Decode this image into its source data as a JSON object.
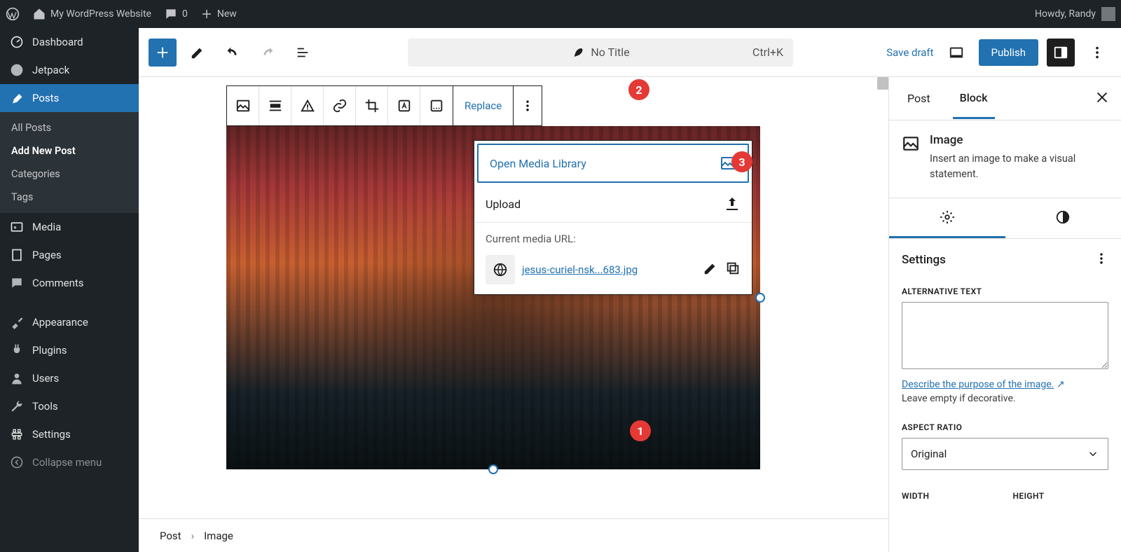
{
  "admin_bar": {
    "site_title": "My WordPress Website",
    "comments_count": "0",
    "new_label": "New",
    "greeting": "Howdy, Randy"
  },
  "sidebar": {
    "items": [
      {
        "label": "Dashboard"
      },
      {
        "label": "Jetpack"
      },
      {
        "label": "Posts"
      },
      {
        "label": "Media"
      },
      {
        "label": "Pages"
      },
      {
        "label": "Comments"
      },
      {
        "label": "Appearance"
      },
      {
        "label": "Plugins"
      },
      {
        "label": "Users"
      },
      {
        "label": "Tools"
      },
      {
        "label": "Settings"
      },
      {
        "label": "Collapse menu"
      }
    ],
    "posts_submenu": [
      "All Posts",
      "Add New Post",
      "Categories",
      "Tags"
    ]
  },
  "editor_header": {
    "title": "No Title",
    "shortcut": "Ctrl+K",
    "save_draft": "Save draft",
    "publish": "Publish"
  },
  "block_toolbar": {
    "replace": "Replace"
  },
  "replace_popover": {
    "open_media": "Open Media Library",
    "upload": "Upload",
    "current_url_label": "Current media URL:",
    "filename": "jesus-curiel-nsk...683.jpg"
  },
  "badges": {
    "b1": "1",
    "b2": "2",
    "b3": "3"
  },
  "inspector": {
    "tab_post": "Post",
    "tab_block": "Block",
    "block_name": "Image",
    "block_desc": "Insert an image to make a visual statement.",
    "settings_label": "Settings",
    "alt_label": "ALTERNATIVE TEXT",
    "describe_link": "Describe the purpose of the image.",
    "describe_sub": "Leave empty if decorative.",
    "aspect_label": "ASPECT RATIO",
    "aspect_value": "Original",
    "width_label": "WIDTH",
    "height_label": "HEIGHT"
  },
  "breadcrumb": {
    "root": "Post",
    "leaf": "Image"
  }
}
